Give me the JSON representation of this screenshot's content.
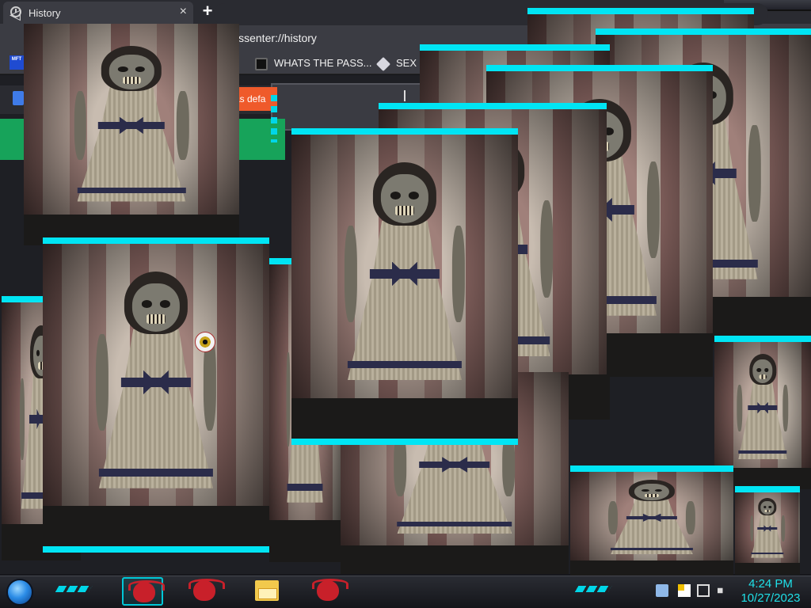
{
  "browser": {
    "tab_title": "History",
    "tab_close": "×",
    "new_tab": "+",
    "back": "◁",
    "url": "issenter://history",
    "bookmarks": [
      {
        "label": "WHATS THE PASS..."
      },
      {
        "label": "SEX D"
      }
    ],
    "bookmark_badge": "MFT",
    "infobar_button": "as defa"
  },
  "taskbar": {
    "time": "4:24 PM",
    "date": "10/27/2023"
  },
  "colors": {
    "accent": "#00e5f4",
    "brand_orange": "#ef5a2b",
    "brand_green": "#17a35a",
    "clock": "#1fe0e8"
  }
}
